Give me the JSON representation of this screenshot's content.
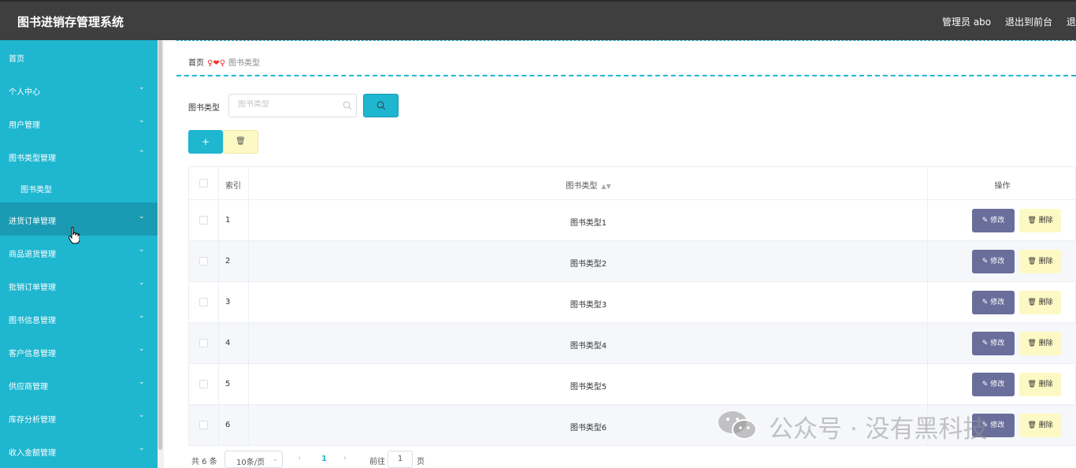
{
  "header": {
    "app_title": "图书进销存管理系统",
    "admin_label": "管理员 abo",
    "front_link": "退出到前台",
    "logout_partial": "退"
  },
  "sidebar": {
    "items": [
      {
        "label": "首页"
      },
      {
        "label": "个人中心"
      },
      {
        "label": "用户管理"
      },
      {
        "label": "图书类型管理"
      },
      {
        "label": "图书类型"
      },
      {
        "label": "进货订单管理"
      },
      {
        "label": "商品退货管理"
      },
      {
        "label": "批销订单管理"
      },
      {
        "label": "图书信息管理"
      },
      {
        "label": "客户信息管理"
      },
      {
        "label": "供应商管理"
      },
      {
        "label": "库存分析管理"
      },
      {
        "label": "收入金额管理"
      }
    ]
  },
  "breadcrumb": {
    "home": "首页",
    "separator": "♀❤♀",
    "current": "图书类型"
  },
  "search": {
    "label": "图书类型",
    "placeholder": "图书类型"
  },
  "toolbar": {
    "add_label": "+",
    "delete_icon": "trash-icon"
  },
  "table": {
    "headers": {
      "index": "索引",
      "type": "图书类型",
      "actions": "操作"
    },
    "rows": [
      {
        "index": "1",
        "type": "图书类型1"
      },
      {
        "index": "2",
        "type": "图书类型2"
      },
      {
        "index": "3",
        "type": "图书类型3"
      },
      {
        "index": "4",
        "type": "图书类型4"
      },
      {
        "index": "5",
        "type": "图书类型5"
      },
      {
        "index": "6",
        "type": "图书类型6"
      }
    ],
    "edit_label": "修改",
    "delete_label": "删除"
  },
  "pagination": {
    "total": "共 6 条",
    "page_size": "10条/页",
    "current_page": "1",
    "goto_label": "前往",
    "goto_value": "1",
    "page_unit": "页"
  },
  "watermark": {
    "text": "公众号 · 没有黑科技"
  },
  "colors": {
    "sidebar": "#1fb6d0",
    "sidebar_active": "#1a9bb3",
    "topbar": "#3f3f3f",
    "edit_button": "#6a6e9b",
    "delete_button": "#fdf9c4"
  }
}
